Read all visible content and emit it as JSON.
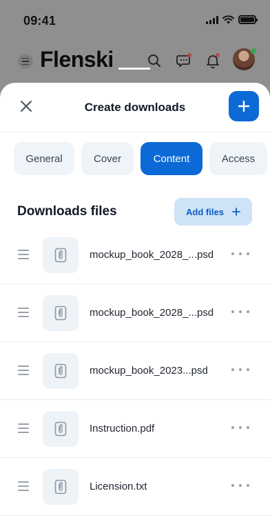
{
  "status_bar": {
    "time": "09:41"
  },
  "background_app": {
    "logo": "Flenski"
  },
  "sheet": {
    "title": "Create downloads",
    "tabs": [
      {
        "label": "General",
        "active": false
      },
      {
        "label": "Cover",
        "active": false
      },
      {
        "label": "Content",
        "active": true
      },
      {
        "label": "Access",
        "active": false
      }
    ],
    "section_title": "Downloads files",
    "add_files_label": "Add files",
    "files": [
      {
        "name": "mockup_book_2028_...psd"
      },
      {
        "name": "mockup_book_2028_...psd"
      },
      {
        "name": "mockup_book_2023...psd"
      },
      {
        "name": "Instruction.pdf"
      },
      {
        "name": "Licension.txt"
      }
    ]
  },
  "colors": {
    "accent": "#0b6ad6",
    "accent_light": "#cfe3f7",
    "tab_inactive": "#eff4f9",
    "overlay": "#8f8f8f"
  },
  "icons": {
    "close": "close-icon",
    "add": "plus-icon",
    "drag": "drag-handle-icon",
    "file": "paperclip-icon",
    "more": "more-horizontal-icon"
  }
}
